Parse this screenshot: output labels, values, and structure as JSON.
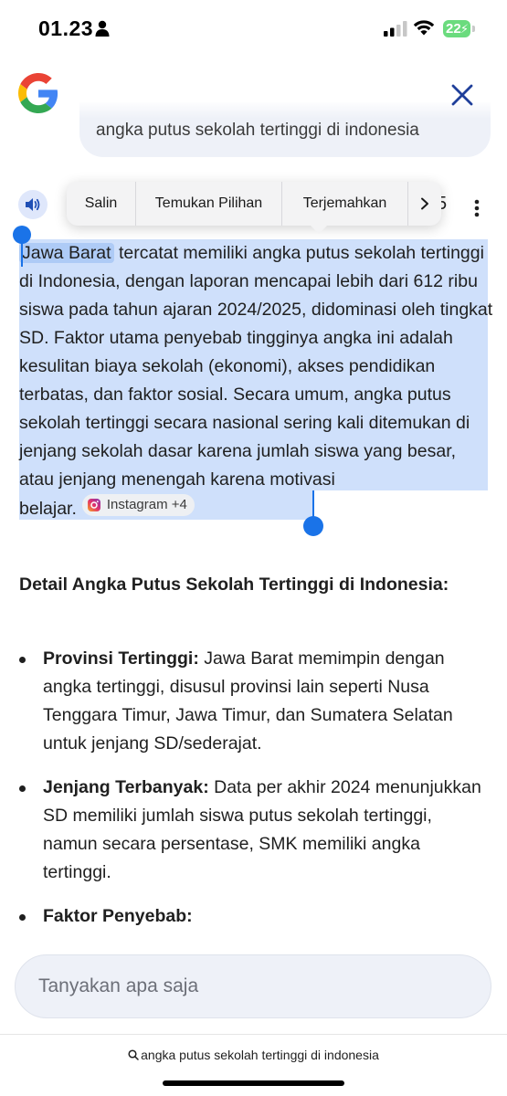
{
  "status_bar": {
    "time": "01.23",
    "battery_level": "22"
  },
  "query": {
    "text": "angka putus sekolah tertinggi di indonesia"
  },
  "context_menu": {
    "items": [
      "Salin",
      "Temukan Pilihan",
      "Terjemahkan"
    ]
  },
  "partial_text": "5",
  "answer": {
    "highlight": "Jawa Barat",
    "text_selected": "tercatat memiliki angka putus sekolah tertinggi di Indonesia, dengan laporan mencapai lebih dari 612 ribu siswa pada tahun ajaran 2024/2025, didominasi oleh tingkat SD. Faktor utama penyebab tingginya angka ini adalah kesulitan biaya sekolah (ekonomi), akses pendidikan terbatas, dan faktor sosial. Secara umum, angka putus sekolah tertinggi secara nasional sering kali ditemukan di jenjang sekolah dasar karena jumlah siswa yang besar, atau jenjang menengah karena motivasi",
    "text_tail": "belajar.",
    "source_chip": "Instagram +4"
  },
  "detail": {
    "title": "Detail Angka Putus Sekolah Tertinggi di Indonesia:",
    "items": [
      {
        "label": "Provinsi Tertinggi:",
        "text": "Jawa Barat memimpin dengan angka tertinggi, disusul provinsi lain seperti Nusa Tenggara Timur, Jawa Timur, dan Sumatera Selatan untuk jenjang SD/sederajat."
      },
      {
        "label": "Jenjang Terbanyak:",
        "text": "Data per akhir 2024 menunjukkan SD memiliki jumlah siswa putus sekolah tertinggi, namun secara persentase, SMK memiliki angka tertinggi."
      },
      {
        "label": "Faktor Penyebab:",
        "text": ""
      }
    ]
  },
  "ask_input": {
    "placeholder": "Tanyakan apa saja"
  },
  "bottom_search": {
    "text": "angka putus sekolah tertinggi di indonesia"
  },
  "colors": {
    "accent": "#1a73e8",
    "selection": "#cfe0fb",
    "input_bg": "#eef1f8",
    "battery": "#6bdb7e"
  },
  "icons": [
    "person-icon",
    "signal-icon",
    "wifi-icon",
    "battery-icon",
    "google-logo",
    "close-icon",
    "speaker-icon",
    "more-vert-icon",
    "chevron-right-icon",
    "instagram-icon",
    "search-icon"
  ]
}
